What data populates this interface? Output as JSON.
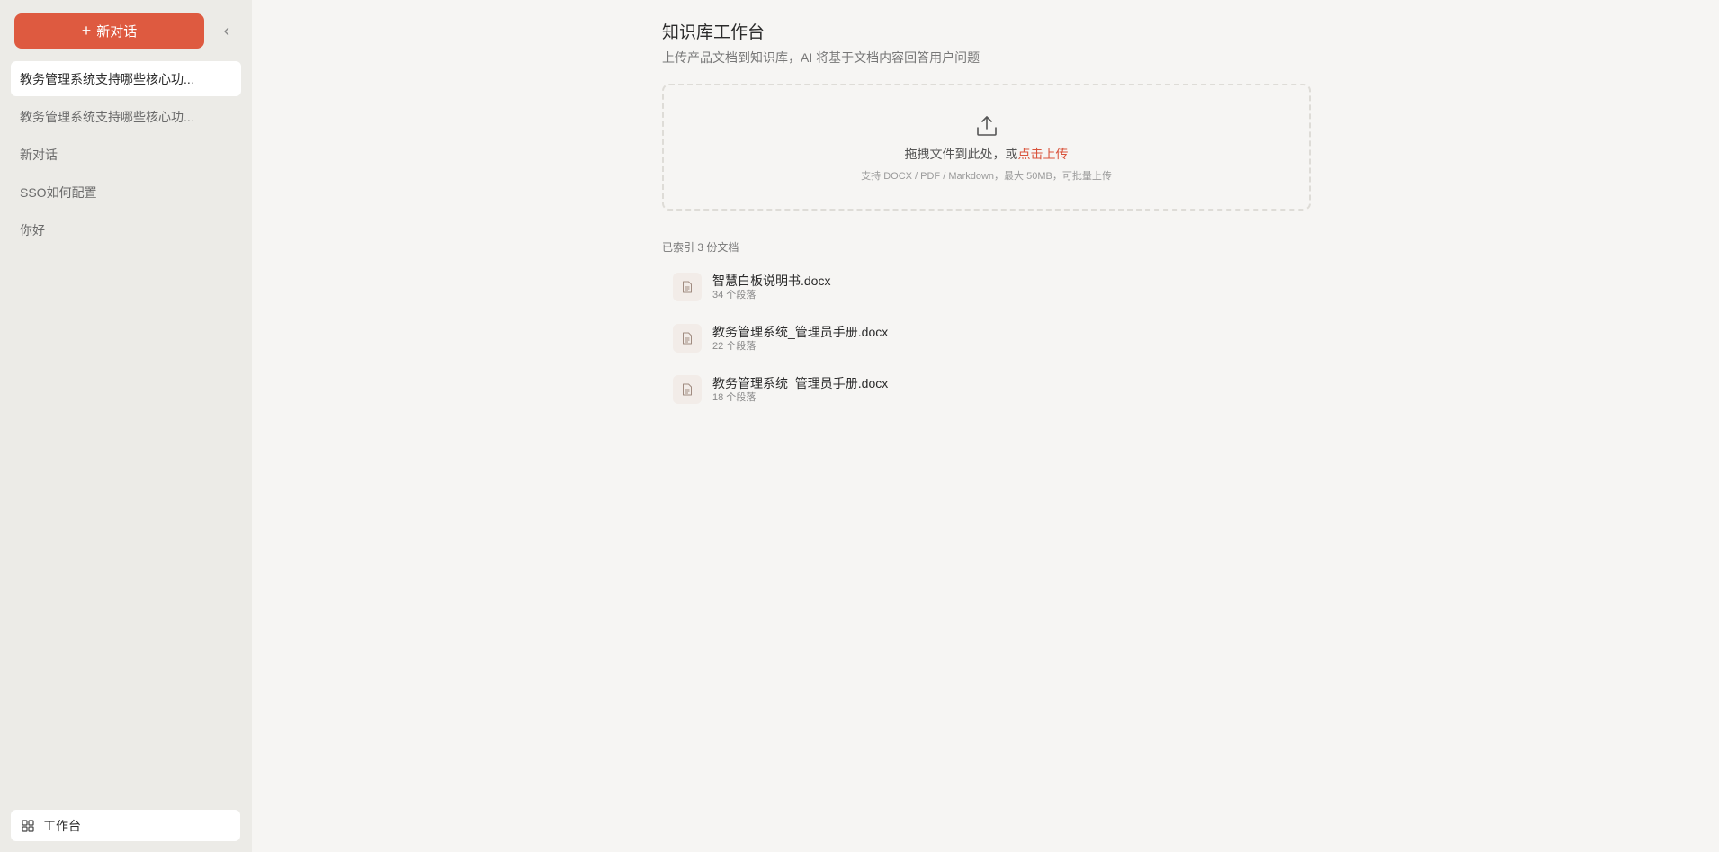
{
  "sidebar": {
    "new_chat_label": "新对话",
    "history": [
      {
        "label": "教务管理系统支持哪些核心功..."
      },
      {
        "label": "教务管理系统支持哪些核心功..."
      },
      {
        "label": "新对话"
      },
      {
        "label": "SSO如何配置"
      },
      {
        "label": "你好"
      }
    ],
    "workspace_label": "工作台"
  },
  "main": {
    "title": "知识库工作台",
    "subtitle": "上传产品文档到知识库，AI 将基于文档内容回答用户问题",
    "upload": {
      "text": "拖拽文件到此处，或",
      "link": "点击上传",
      "hint": "支持 DOCX / PDF / Markdown，最大 50MB，可批量上传"
    },
    "doc_count": "已索引 3 份文档",
    "documents": [
      {
        "name": "智慧白板说明书.docx",
        "meta": "34 个段落"
      },
      {
        "name": "教务管理系统_管理员手册.docx",
        "meta": "22 个段落"
      },
      {
        "name": "教务管理系统_管理员手册.docx",
        "meta": "18 个段落"
      }
    ]
  },
  "colors": {
    "accent": "#de5a40",
    "sidebar_bg": "#ecebe7",
    "main_bg": "#f6f5f3"
  },
  "icons": {
    "new_chat": "plus-icon",
    "collapse": "chevron-left-icon",
    "upload": "upload-icon",
    "document": "document-icon",
    "workspace": "grid-icon"
  }
}
